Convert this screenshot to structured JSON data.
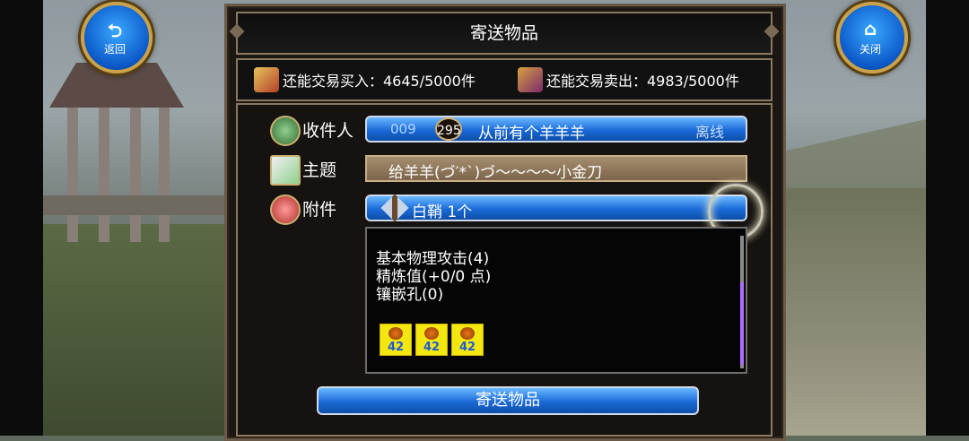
{
  "nav": {
    "back_label": "返回",
    "close_label": "关闭"
  },
  "panel": {
    "title": "寄送物品"
  },
  "trade": {
    "buy_label": "还能交易买入：4645/5000件",
    "sell_label": "还能交易卖出：4983/5000件"
  },
  "form": {
    "recipient_label": "收件人",
    "subject_label": "主题",
    "attachment_label": "附件",
    "recipient": {
      "id": "009",
      "level": "295",
      "name": "从前有个羊羊羊",
      "status": "离线"
    },
    "subject_value": "给羊羊(づ′*`)づ～～～～小金刀",
    "attachment_item": "白鞘 1个"
  },
  "detail": {
    "lines": [
      "基本物理攻击(4)",
      "精炼值(+0/0 点)",
      "镶嵌孔(0)"
    ],
    "gems": [
      "42",
      "42",
      "42"
    ]
  },
  "actions": {
    "send_label": "寄送物品"
  },
  "icons": {
    "back": "back-arrow-icon",
    "close": "home-icon",
    "buy": "treasure-chest-icon",
    "sell": "treasure-chest-icon",
    "recipient": "person-icon",
    "subject": "envelope-icon",
    "attachment": "gift-icon",
    "item": "sword-icon",
    "gem": "gem-icon"
  },
  "colors": {
    "button_blue": "#1a6ad8",
    "gem_bg": "#f4e60f",
    "scroll_thumb": "#b06cff"
  }
}
